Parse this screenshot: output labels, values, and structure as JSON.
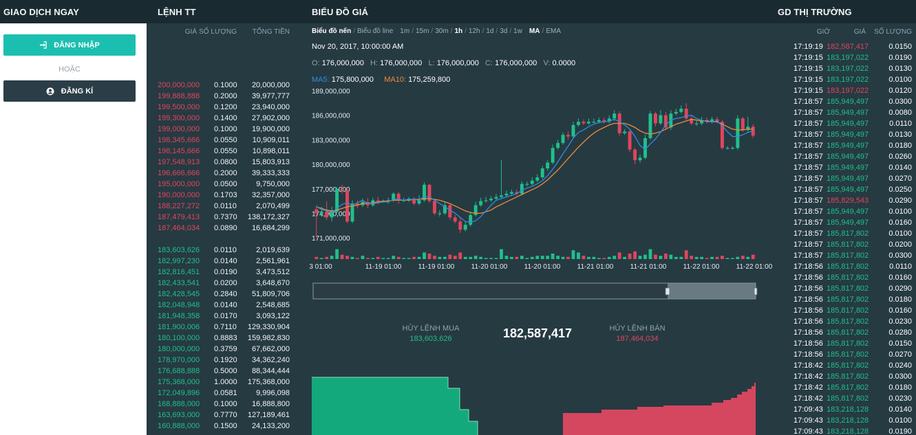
{
  "headers": {
    "trade_now": "GIAO DỊCH NGAY",
    "orders": "LỆNH TT",
    "price_chart": "BIỂU ĐỒ GIÁ",
    "market_trades": "GD THỊ TRƯỜNG"
  },
  "auth": {
    "login_label": "ĐĂNG NHẬP",
    "or_label": "HOẶC",
    "register_label": "ĐĂNG KÍ",
    "login_icon": "sign-in-icon",
    "register_icon": "user-circle-icon",
    "login_color": "#1bbfb0"
  },
  "orderbook": {
    "columns": [
      "GIÁ",
      "SỐ LƯỢNG",
      "TỔNG TIỀN"
    ],
    "sell": [
      [
        "200,000,000",
        "0.1000",
        "20,000,000"
      ],
      [
        "199,888,888",
        "0.2000",
        "39,977,777"
      ],
      [
        "199,500,000",
        "0.1200",
        "23,940,000"
      ],
      [
        "199,300,000",
        "0.1400",
        "27,902,000"
      ],
      [
        "199,000,000",
        "0.1000",
        "19,900,000"
      ],
      [
        "198,345,666",
        "0.0550",
        "10,909,011"
      ],
      [
        "198,145,666",
        "0.0550",
        "10,898,011"
      ],
      [
        "197,548,913",
        "0.0800",
        "15,803,913"
      ],
      [
        "196,666,666",
        "0.2000",
        "39,333,333"
      ],
      [
        "195,000,000",
        "0.0500",
        "9,750,000"
      ],
      [
        "190,000,000",
        "0.1703",
        "32,357,000"
      ],
      [
        "188,227,272",
        "0.0110",
        "2,070,499"
      ],
      [
        "187,479,413",
        "0.7370",
        "138,172,327"
      ],
      [
        "187,464,034",
        "0.0890",
        "16,684,299"
      ]
    ],
    "buy": [
      [
        "183,603,626",
        "0.0110",
        "2,019,639"
      ],
      [
        "182,997,230",
        "0.0140",
        "2,561,961"
      ],
      [
        "182,816,451",
        "0.0190",
        "3,473,512"
      ],
      [
        "182,433,541",
        "0.0200",
        "3,648,670"
      ],
      [
        "182,428,545",
        "0.2840",
        "51,809,706"
      ],
      [
        "182,048,948",
        "0.0140",
        "2,548,685"
      ],
      [
        "181,948,358",
        "0.0170",
        "3,093,122"
      ],
      [
        "181,900,006",
        "0.7110",
        "129,330,904"
      ],
      [
        "180,100,000",
        "0.8883",
        "159,982,830"
      ],
      [
        "180,000,000",
        "0.3759",
        "67,662,000"
      ],
      [
        "178,970,000",
        "0.1920",
        "34,362,240"
      ],
      [
        "176,688,888",
        "0.5000",
        "88,344,444"
      ],
      [
        "175,368,000",
        "1.0000",
        "175,368,000"
      ],
      [
        "172,049,896",
        "0.0581",
        "9,996,098"
      ],
      [
        "168,888,000",
        "0.1000",
        "16,888,800"
      ],
      [
        "163,693,000",
        "0.7770",
        "127,189,461"
      ],
      [
        "160,888,000",
        "0.1500",
        "24,133,200"
      ]
    ],
    "sell_color": "#e0455c",
    "buy_color": "#1fc08a"
  },
  "toolbar": {
    "chart_types": [
      {
        "label": "Biểu đồ nến",
        "active": true
      },
      {
        "label": "Biểu đồ line",
        "active": false
      }
    ],
    "intervals": [
      {
        "label": "1m",
        "active": false
      },
      {
        "label": "15m",
        "active": false
      },
      {
        "label": "30m",
        "active": false
      },
      {
        "label": "1h",
        "active": true
      },
      {
        "label": "12h",
        "active": false
      },
      {
        "label": "1d",
        "active": false
      },
      {
        "label": "3d",
        "active": false
      },
      {
        "label": "1w",
        "active": false
      }
    ],
    "indicators": [
      {
        "label": "MA",
        "active": true
      },
      {
        "label": "EMA",
        "active": false
      }
    ]
  },
  "ohlc": {
    "datetime": "Nov 20, 2017, 10:00:00 AM",
    "o_label": "O:",
    "o": "176,000,000",
    "h_label": "H:",
    "h": "176,000,000",
    "l_label": "L:",
    "l": "176,000,000",
    "c_label": "C:",
    "c": "176,000,000",
    "v_label": "V:",
    "v": "0.0000",
    "ma5_label": "MA5:",
    "ma5": "175,800,000",
    "ma10_label": "MA10:",
    "ma10": "175,259,800"
  },
  "chart_data": {
    "type": "candlestick",
    "y_ticks": [
      "189,000,000",
      "186,000,000",
      "183,000,000",
      "180,000,000",
      "177,000,000",
      "174,000,000",
      "171,000,000"
    ],
    "y_tick_values": [
      189000000,
      186000000,
      183000000,
      180000000,
      177000000,
      174000000,
      171000000
    ],
    "ylim": [
      169500000,
      189500000
    ],
    "x_ticks": [
      "3 01:00",
      "11-19 01:00",
      "11-19 01:00",
      "11-20 01:00",
      "11-20 01:00",
      "11-21 01:00",
      "11-21 01:00",
      "11-22 01:00",
      "11-22 01:00"
    ],
    "candles": [
      [
        174.5,
        174.0,
        175.0,
        171.0
      ],
      [
        174.0,
        174.2,
        174.8,
        173.6
      ],
      [
        174.2,
        173.5,
        175.5,
        173.2
      ],
      [
        173.5,
        174.2,
        174.8,
        173.0
      ],
      [
        174.2,
        177.0,
        177.2,
        174.0
      ],
      [
        177.0,
        176.8,
        177.5,
        176.4
      ],
      [
        176.8,
        173.0,
        177.0,
        172.8
      ],
      [
        173.0,
        175.2,
        175.6,
        172.8
      ],
      [
        175.2,
        175.0,
        175.6,
        174.6
      ],
      [
        175.0,
        175.4,
        175.8,
        174.8
      ],
      [
        175.4,
        175.0,
        175.9,
        174.6
      ],
      [
        175.0,
        175.6,
        175.9,
        174.8
      ],
      [
        175.6,
        175.5,
        176.0,
        175.1
      ],
      [
        175.5,
        175.5,
        175.7,
        175.3
      ],
      [
        175.5,
        175.6,
        175.9,
        175.2
      ],
      [
        175.6,
        176.4,
        176.6,
        175.4
      ],
      [
        176.4,
        175.6,
        176.6,
        175.2
      ],
      [
        175.6,
        175.6,
        175.9,
        175.4
      ],
      [
        175.6,
        175.8,
        176.0,
        175.4
      ],
      [
        175.8,
        175.2,
        176.0,
        175.0
      ],
      [
        175.2,
        175.6,
        176.2,
        175.0
      ],
      [
        175.6,
        177.5,
        177.8,
        175.4
      ],
      [
        177.5,
        175.5,
        177.6,
        175.3
      ],
      [
        175.5,
        174.0,
        175.7,
        173.8
      ],
      [
        174.0,
        174.0,
        174.4,
        173.6
      ],
      [
        174.0,
        175.0,
        175.4,
        173.8
      ],
      [
        175.0,
        173.5,
        175.2,
        173.2
      ],
      [
        173.5,
        173.0,
        173.8,
        172.8
      ],
      [
        173.0,
        172.0,
        173.4,
        171.6
      ],
      [
        172.0,
        172.6,
        173.0,
        171.8
      ],
      [
        172.6,
        173.8,
        174.2,
        172.4
      ],
      [
        173.8,
        175.0,
        175.4,
        173.6
      ],
      [
        175.0,
        175.5,
        175.9,
        174.8
      ],
      [
        175.5,
        175.6,
        176.0,
        175.3
      ],
      [
        175.6,
        175.8,
        176.1,
        175.4
      ],
      [
        175.8,
        176.0,
        176.4,
        175.6
      ],
      [
        176.0,
        176.2,
        180.5,
        175.8
      ],
      [
        176.2,
        176.4,
        176.8,
        176.0
      ],
      [
        176.4,
        176.6,
        176.9,
        176.2
      ],
      [
        176.6,
        176.4,
        176.9,
        176.2
      ],
      [
        176.4,
        177.6,
        177.9,
        176.2
      ],
      [
        177.6,
        177.6,
        177.9,
        177.3
      ],
      [
        177.6,
        178.0,
        178.4,
        177.4
      ],
      [
        178.0,
        178.4,
        178.8,
        177.8
      ],
      [
        178.4,
        179.5,
        179.8,
        178.2
      ],
      [
        179.5,
        180.2,
        180.5,
        179.2
      ],
      [
        180.2,
        182.0,
        182.4,
        180.0
      ],
      [
        182.0,
        182.6,
        183.0,
        181.8
      ],
      [
        182.6,
        183.6,
        183.9,
        182.4
      ],
      [
        183.6,
        183.4,
        184.0,
        183.0
      ],
      [
        183.4,
        184.8,
        185.2,
        183.2
      ],
      [
        184.8,
        185.2,
        185.6,
        184.6
      ],
      [
        185.2,
        185.0,
        185.5,
        184.8
      ],
      [
        185.0,
        185.2,
        185.6,
        184.8
      ],
      [
        185.2,
        185.2,
        185.6,
        185.0
      ],
      [
        185.2,
        185.4,
        185.7,
        185.0
      ],
      [
        185.4,
        185.2,
        185.7,
        185.0
      ],
      [
        185.2,
        185.6,
        186.0,
        185.0
      ],
      [
        185.6,
        186.2,
        186.6,
        185.3
      ],
      [
        186.2,
        183.8,
        186.5,
        183.5
      ],
      [
        183.8,
        184.0,
        184.3,
        183.6
      ],
      [
        184.0,
        181.8,
        184.2,
        181.5
      ],
      [
        181.8,
        180.5,
        182.0,
        180.0
      ],
      [
        180.5,
        180.8,
        181.2,
        180.2
      ],
      [
        180.8,
        183.2,
        183.6,
        180.6
      ],
      [
        183.2,
        186.2,
        186.5,
        183.0
      ],
      [
        186.2,
        185.0,
        186.4,
        184.6
      ],
      [
        185.0,
        186.0,
        186.6,
        184.8
      ],
      [
        186.0,
        184.5,
        186.4,
        184.2
      ],
      [
        184.5,
        186.2,
        186.6,
        184.2
      ],
      [
        186.2,
        186.4,
        186.8,
        186.0
      ],
      [
        186.4,
        186.8,
        187.2,
        186.2
      ],
      [
        186.8,
        185.6,
        187.5,
        185.4
      ],
      [
        185.6,
        185.0,
        185.9,
        184.8
      ],
      [
        185.0,
        185.0,
        185.3,
        184.7
      ],
      [
        185.0,
        185.4,
        185.8,
        184.8
      ],
      [
        185.4,
        185.2,
        185.7,
        185.0
      ],
      [
        185.2,
        185.5,
        185.8,
        185.0
      ],
      [
        185.5,
        185.2,
        185.8,
        185.0
      ],
      [
        185.2,
        182.0,
        185.4,
        181.8
      ],
      [
        182.0,
        182.0,
        182.2,
        181.8
      ],
      [
        182.0,
        182.0,
        182.2,
        181.8
      ],
      [
        182.0,
        185.6,
        186.0,
        181.8
      ],
      [
        185.6,
        184.2,
        185.8,
        184.0
      ],
      [
        184.2,
        184.6,
        185.8,
        184.0
      ],
      [
        184.6,
        183.5,
        184.9,
        183.2
      ]
    ],
    "volumes": [
      0.2,
      0.1,
      0.2,
      0.3,
      0.9,
      0.4,
      0.3,
      0.2,
      0.1,
      0.3,
      0.1,
      0.1,
      0.2,
      0.1,
      0.1,
      0.3,
      0.2,
      0.1,
      0.1,
      0.2,
      0.2,
      0.6,
      0.5,
      0.3,
      0.2,
      0.2,
      0.4,
      0.3,
      0.6,
      0.2,
      0.2,
      0.3,
      0.2,
      0.1,
      0.1,
      0.1,
      0.9,
      0.3,
      0.2,
      0.2,
      0.3,
      0.1,
      0.2,
      0.3,
      0.3,
      0.3,
      0.5,
      0.3,
      0.2,
      0.2,
      0.8,
      0.6,
      0.3,
      0.2,
      0.2,
      0.1,
      0.1,
      0.2,
      0.3,
      0.6,
      0.2,
      0.5,
      0.7,
      0.3,
      0.4,
      0.9,
      0.4,
      0.3,
      0.5,
      0.4,
      0.2,
      0.2,
      0.8,
      0.3,
      0.2,
      0.2,
      0.1,
      0.2,
      0.2,
      0.3,
      0.1,
      0.1,
      0.2,
      0.3,
      0.2,
      0.4
    ],
    "ma5": [
      174.8,
      174.5,
      174.3,
      174.1,
      174.6,
      175.1,
      175.3,
      175.0,
      175.3,
      175.6,
      175.2,
      175.2,
      175.3,
      175.4,
      175.4,
      175.7,
      175.7,
      175.6,
      175.7,
      175.7,
      175.6,
      176.1,
      176.0,
      175.6,
      175.2,
      174.8,
      174.4,
      174.0,
      173.5,
      173.0,
      172.9,
      173.1,
      173.6,
      174.3,
      175.0,
      175.6,
      175.8,
      176.0,
      176.2,
      176.4,
      176.8,
      177.1,
      177.3,
      177.6,
      178.0,
      178.6,
      179.4,
      180.3,
      181.3,
      182.2,
      183.2,
      183.9,
      184.2,
      184.6,
      184.9,
      185.1,
      185.2,
      185.3,
      185.5,
      185.2,
      184.8,
      184.3,
      183.4,
      182.3,
      181.8,
      182.5,
      183.1,
      183.9,
      184.8,
      185.4,
      185.6,
      185.7,
      185.9,
      186.0,
      185.6,
      185.4,
      185.2,
      185.2,
      185.3,
      184.7,
      184.0,
      183.4,
      183.4,
      183.6,
      183.9,
      184.1
    ],
    "ma10": [
      174.8,
      174.6,
      174.4,
      174.3,
      174.4,
      174.6,
      174.8,
      174.9,
      175.0,
      175.2,
      175.2,
      175.3,
      175.4,
      175.5,
      175.5,
      175.6,
      175.6,
      175.6,
      175.6,
      175.7,
      175.7,
      175.8,
      175.8,
      175.7,
      175.6,
      175.4,
      175.2,
      174.9,
      174.6,
      174.3,
      174.1,
      174.0,
      174.0,
      174.2,
      174.4,
      174.8,
      175.1,
      175.4,
      175.7,
      176.0,
      176.3,
      176.6,
      176.9,
      177.2,
      177.6,
      178.1,
      178.7,
      179.3,
      180.0,
      180.7,
      181.4,
      182.1,
      182.7,
      183.3,
      183.8,
      184.2,
      184.5,
      184.8,
      185.0,
      185.0,
      185.0,
      184.8,
      184.5,
      184.1,
      183.8,
      183.7,
      183.8,
      184.0,
      184.3,
      184.6,
      184.9,
      185.1,
      185.3,
      185.5,
      185.4,
      185.3,
      185.3,
      185.2,
      185.2,
      184.9,
      184.6,
      184.3,
      184.2,
      184.2,
      184.3,
      184.3
    ]
  },
  "order_depth": {
    "cancel_buy_label": "HỦY LỆNH MUA",
    "cancel_buy_value": "183,603,626",
    "last_price": "182,587,417",
    "cancel_sell_label": "HỦY LỆNH BÁN",
    "cancel_sell_value": "187,464,034"
  },
  "trades": {
    "columns": [
      "GIỜ",
      "GIÁ",
      "SỐ LƯỢNG"
    ],
    "rows": [
      [
        "17:19:19",
        "182,587,417",
        "0.0150",
        "down"
      ],
      [
        "17:19:15",
        "183,197,022",
        "0.0190",
        "up"
      ],
      [
        "17:19:15",
        "183,197,022",
        "0.0130",
        "up"
      ],
      [
        "17:19:15",
        "183,197,022",
        "0.0100",
        "up"
      ],
      [
        "17:19:15",
        "183,197,022",
        "0.0120",
        "down"
      ],
      [
        "17:18:57",
        "185,949,497",
        "0.0300",
        "up"
      ],
      [
        "17:18:57",
        "185,949,497",
        "0.0080",
        "up"
      ],
      [
        "17:18:57",
        "185,949,497",
        "0.0110",
        "up"
      ],
      [
        "17:18:57",
        "185,949,497",
        "0.0130",
        "up"
      ],
      [
        "17:18:57",
        "185,949,497",
        "0.0180",
        "up"
      ],
      [
        "17:18:57",
        "185,949,497",
        "0.0260",
        "up"
      ],
      [
        "17:18:57",
        "185,949,497",
        "0.0140",
        "up"
      ],
      [
        "17:18:57",
        "185,949,497",
        "0.0270",
        "up"
      ],
      [
        "17:18:57",
        "185,949,497",
        "0.0250",
        "up"
      ],
      [
        "17:18:57",
        "185,829,543",
        "0.0290",
        "down"
      ],
      [
        "17:18:57",
        "185,949,497",
        "0.0100",
        "up"
      ],
      [
        "17:18:57",
        "185,949,497",
        "0.0160",
        "up"
      ],
      [
        "17:18:57",
        "185,817,802",
        "0.0100",
        "up"
      ],
      [
        "17:18:57",
        "185,817,802",
        "0.0200",
        "up"
      ],
      [
        "17:18:57",
        "185,817,802",
        "0.0300",
        "up"
      ],
      [
        "17:18:56",
        "185,817,802",
        "0.0110",
        "up"
      ],
      [
        "17:18:56",
        "185,817,802",
        "0.0160",
        "up"
      ],
      [
        "17:18:56",
        "185,817,802",
        "0.0290",
        "up"
      ],
      [
        "17:18:56",
        "185,817,802",
        "0.0180",
        "up"
      ],
      [
        "17:18:56",
        "185,817,802",
        "0.0160",
        "up"
      ],
      [
        "17:18:56",
        "185,817,802",
        "0.0230",
        "up"
      ],
      [
        "17:18:56",
        "185,817,802",
        "0.0280",
        "up"
      ],
      [
        "17:18:56",
        "185,817,802",
        "0.0150",
        "up"
      ],
      [
        "17:18:56",
        "185,817,802",
        "0.0270",
        "up"
      ],
      [
        "17:18:42",
        "185,817,802",
        "0.0240",
        "up"
      ],
      [
        "17:18:42",
        "185,817,802",
        "0.0300",
        "up"
      ],
      [
        "17:18:42",
        "185,817,802",
        "0.0180",
        "up"
      ],
      [
        "17:18:42",
        "185,817,802",
        "0.0230",
        "up"
      ],
      [
        "17:09:43",
        "183,218,128",
        "0.0140",
        "up"
      ],
      [
        "17:09:43",
        "183,218,128",
        "0.0100",
        "up"
      ],
      [
        "17:09:43",
        "183,218,128",
        "0.0190",
        "up"
      ]
    ]
  },
  "colors": {
    "up": "#1fc08a",
    "down": "#e0455c",
    "ma5": "#2f8de0",
    "ma10": "#f08c3a",
    "depth_buy": "#14a97c",
    "depth_sell": "#d4475f"
  }
}
